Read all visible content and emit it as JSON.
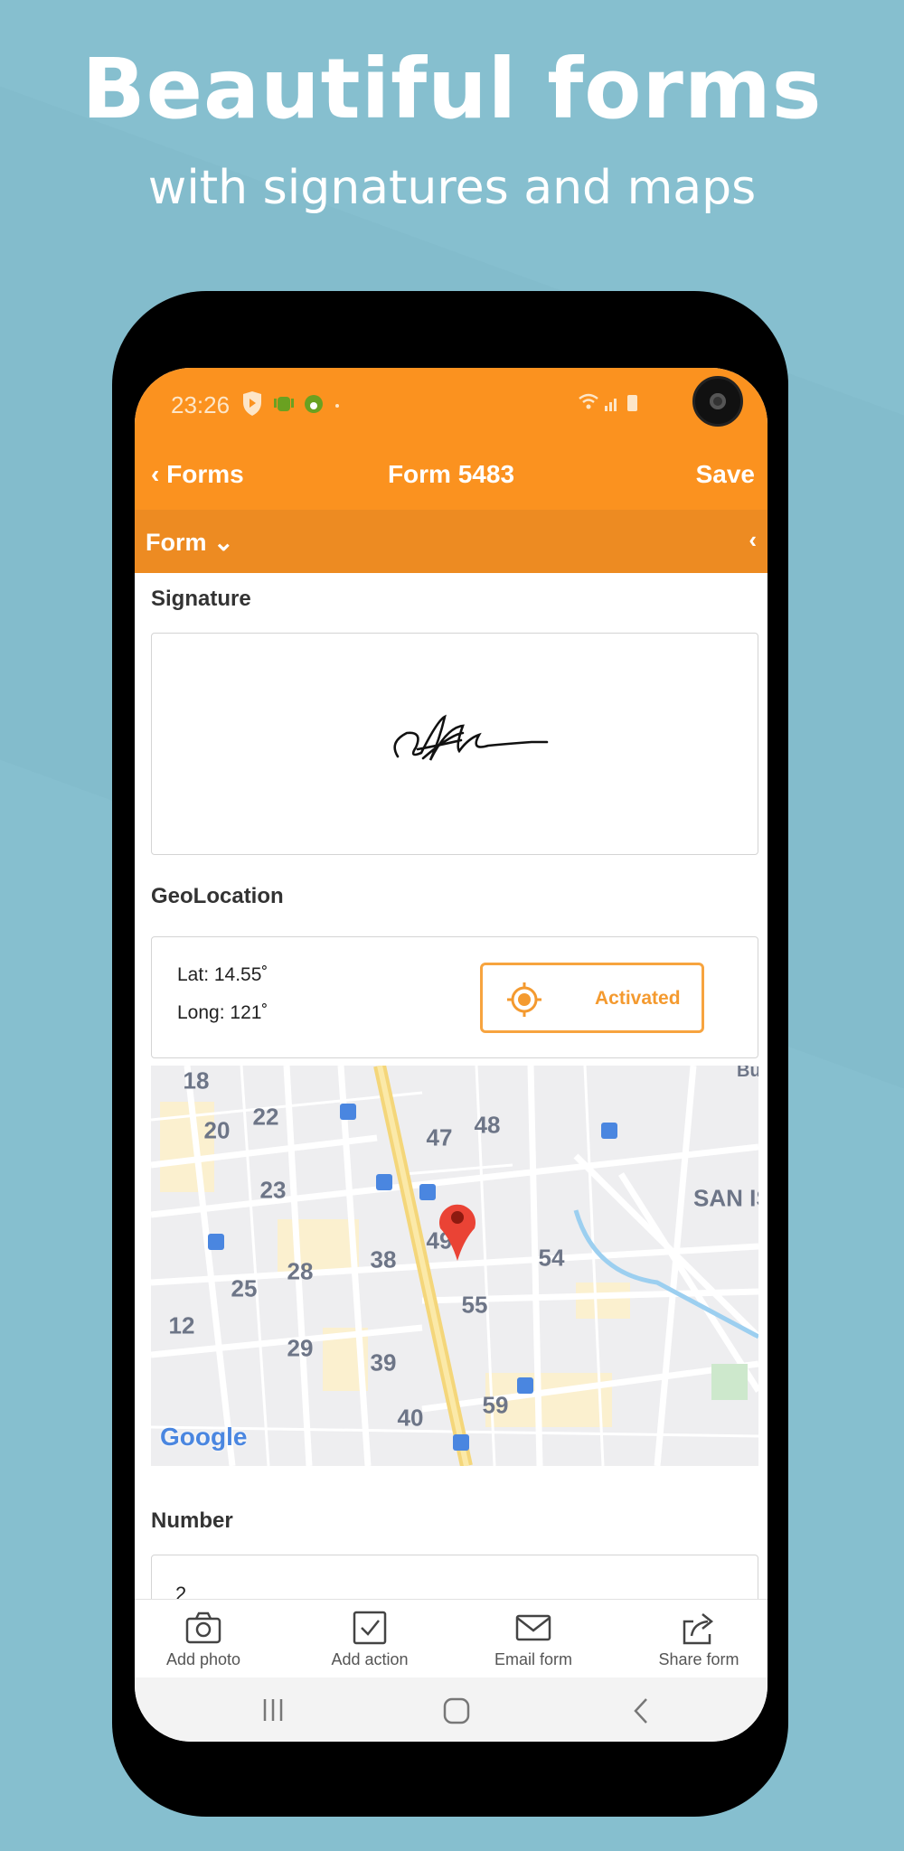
{
  "hero": {
    "title": "Beautiful forms",
    "subtitle": "with signatures and maps"
  },
  "status_bar": {
    "time": "23:26"
  },
  "nav": {
    "back_label": "Forms",
    "title": "Form 5483",
    "save_label": "Save"
  },
  "form_bar": {
    "label": "Form"
  },
  "signature": {
    "label": "Signature"
  },
  "geolocation": {
    "label": "GeoLocation",
    "lat": "Lat: 14.55˚",
    "long": "Long: 121˚",
    "button_label": "Activated"
  },
  "map": {
    "labels": [
      "18",
      "20",
      "22",
      "23",
      "47",
      "48",
      "38",
      "28",
      "25",
      "12",
      "29",
      "39",
      "40",
      "49",
      "54",
      "55",
      "59",
      "SAN IS",
      "Bu"
    ],
    "logo": "Google"
  },
  "number": {
    "label": "Number",
    "value": "2"
  },
  "toolbar": {
    "items": [
      {
        "label": "Add photo",
        "icon": "camera-icon"
      },
      {
        "label": "Add action",
        "icon": "checkbox-icon"
      },
      {
        "label": "Email form",
        "icon": "envelope-icon"
      },
      {
        "label": "Share form",
        "icon": "share-icon"
      }
    ]
  },
  "colors": {
    "accent": "#fb921f",
    "background": "#86bfcf"
  }
}
